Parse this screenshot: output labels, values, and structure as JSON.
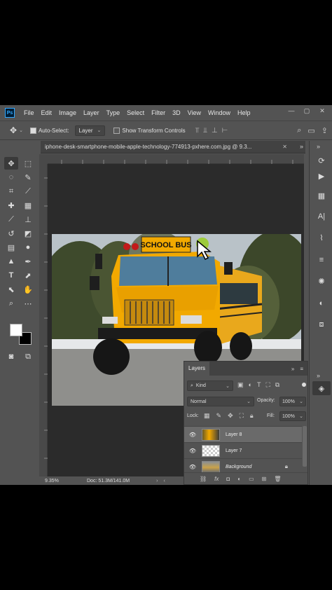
{
  "menu": {
    "logo": "Ps",
    "items": [
      "File",
      "Edit",
      "Image",
      "Layer",
      "Type",
      "Select",
      "Filter",
      "3D",
      "View",
      "Window",
      "Help"
    ],
    "window_controls": [
      "—",
      "▢",
      "✕"
    ]
  },
  "options": {
    "auto_select_label": "Auto-Select:",
    "auto_select_value": "Layer",
    "show_transform_label": "Show Transform Controls"
  },
  "document": {
    "tab_title": "iphone-desk-smartphone-mobile-apple-technology-774913-pxhere.com.jpg @ 9.3...",
    "close": "✕"
  },
  "photo": {
    "bus_sign": "SCHOOL BUS"
  },
  "status": {
    "zoom": "9.35%",
    "doc_size": "Doc: 51.3M/141.0M"
  },
  "layers": {
    "tab_label": "Layers",
    "kind_label": "Kind",
    "blend_mode": "Normal",
    "opacity_label": "Opacity:",
    "opacity_value": "100%",
    "lock_label": "Lock:",
    "fill_label": "Fill:",
    "fill_value": "100%",
    "items": [
      {
        "name": "Layer 8",
        "selected": true
      },
      {
        "name": "Layer 7",
        "selected": false
      },
      {
        "name": "Background",
        "selected": false,
        "locked": true
      }
    ]
  },
  "colors": {
    "ui_bg": "#535353",
    "canvas_bg": "#2b2b2b",
    "accent": "#31a8ff",
    "bus_yellow": "#f2a900"
  }
}
